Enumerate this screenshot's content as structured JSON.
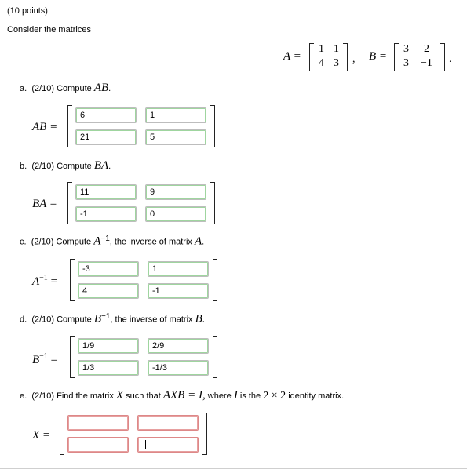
{
  "header": {
    "points": "(10 points)",
    "intro": "Consider the matrices"
  },
  "given": {
    "A_label": "A =",
    "A": [
      [
        "1",
        "1"
      ],
      [
        "4",
        "3"
      ]
    ],
    "separator": ",",
    "B_label": "B =",
    "B": [
      [
        "3",
        "2"
      ],
      [
        "3",
        "−1"
      ]
    ],
    "end": "."
  },
  "parts": [
    {
      "letter": "a.",
      "text": "(2/10) Compute",
      "math": "AB",
      "post": ".",
      "lhs": "AB =",
      "values": [
        "6",
        "1",
        "21",
        "5"
      ]
    },
    {
      "letter": "b.",
      "text": "(2/10) Compute",
      "math": "BA",
      "post": ".",
      "lhs": "BA =",
      "values": [
        "11",
        "9",
        "-1",
        "0"
      ]
    },
    {
      "letter": "c.",
      "text": "(2/10) Compute",
      "math": "A",
      "sup": "−1",
      "post": ", the inverse of matrix",
      "math2": "A",
      "post2": ".",
      "lhs": "A",
      "lhs_sup": "−1",
      "lhs_eq": "=",
      "values": [
        "-3",
        "1",
        "4",
        "-1"
      ]
    },
    {
      "letter": "d.",
      "text": "(2/10) Compute",
      "math": "B",
      "sup": "−1",
      "post": ", the inverse of matrix",
      "math2": "B",
      "post2": ".",
      "lhs": "B",
      "lhs_sup": "−1",
      "lhs_eq": "=",
      "values": [
        "1/9",
        "2/9",
        "1/3",
        "-1/3"
      ]
    },
    {
      "letter": "e.",
      "text": "(2/10) Find the matrix",
      "math": "X",
      "mid": "such that",
      "eq": "AXB = I,",
      "post": "where",
      "math2": "I",
      "post2": "is the",
      "dims": "2 × 2",
      "post3": "identity matrix.",
      "lhs": "X =",
      "values": [
        "",
        "",
        "",
        ""
      ]
    }
  ]
}
